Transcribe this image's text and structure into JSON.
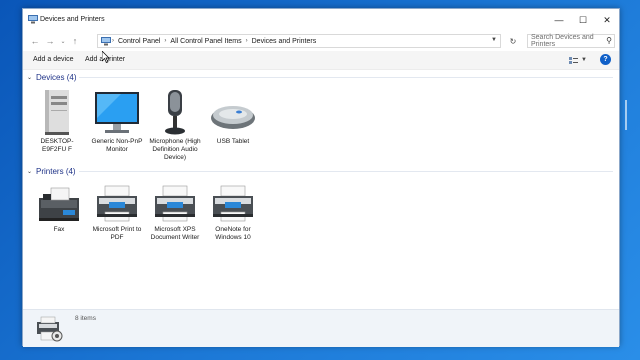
{
  "window": {
    "title": "Devices and Printers",
    "controls": {
      "minimize": "—",
      "maximize": "☐",
      "close": "✕"
    }
  },
  "nav": {
    "back_icon": "left-arrow-icon",
    "forward_icon": "right-arrow-icon",
    "recent_icon": "chevron-down-icon",
    "up_icon": "up-arrow-icon",
    "breadcrumbs": [
      "Control Panel",
      "All Control Panel Items",
      "Devices and Printers"
    ],
    "separator": "›",
    "search_placeholder": "Search Devices and Printers"
  },
  "command_bar": {
    "add_device": "Add a device",
    "add_printer": "Add a printer"
  },
  "groups": {
    "devices": {
      "label": "Devices (4)",
      "items": [
        {
          "label": "DESKTOP-E9F2FU F",
          "icon": "computer-tower-icon"
        },
        {
          "label": "Generic Non-PnP Monitor",
          "icon": "monitor-icon"
        },
        {
          "label": "Microphone (High Definition Audio Device)",
          "icon": "microphone-icon"
        },
        {
          "label": "USB Tablet",
          "icon": "mouse-icon"
        }
      ]
    },
    "printers": {
      "label": "Printers (4)",
      "items": [
        {
          "label": "Fax",
          "icon": "fax-icon"
        },
        {
          "label": "Microsoft Print to PDF",
          "icon": "printer-icon"
        },
        {
          "label": "Microsoft XPS Document Writer",
          "icon": "printer-icon"
        },
        {
          "label": "OneNote for Windows 10",
          "icon": "printer-icon"
        }
      ]
    }
  },
  "details": {
    "count": "8 items"
  },
  "colors": {
    "group_header": "#1e3287",
    "desktop": "#1c78d6",
    "help": "#1060c8"
  }
}
